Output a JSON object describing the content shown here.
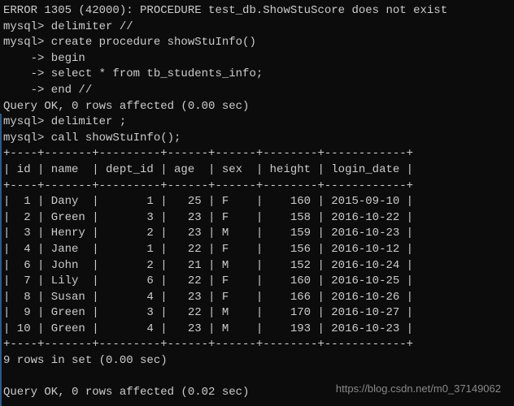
{
  "lines": {
    "l0": "ERROR 1305 (42000): PROCEDURE test_db.ShowStuScore does not exist",
    "l1": "mysql> delimiter //",
    "l2": "mysql> create procedure showStuInfo()",
    "l3": "    -> begin",
    "l4": "    -> select * from tb_students_info;",
    "l5": "    -> end //",
    "l6": "Query OK, 0 rows affected (0.00 sec)",
    "l7": "",
    "l8": "mysql> delimiter ;",
    "l9": "mysql> call showStuInfo();",
    "border": "+----+-------+---------+------+------+--------+------------+",
    "header": "| id | name  | dept_id | age  | sex  | height | login_date |",
    "r1": "|  1 | Dany  |       1 |   25 | F    |    160 | 2015-09-10 |",
    "r2": "|  2 | Green |       3 |   23 | F    |    158 | 2016-10-22 |",
    "r3": "|  3 | Henry |       2 |   23 | M    |    159 | 2016-10-23 |",
    "r4": "|  4 | Jane  |       1 |   22 | F    |    156 | 2016-10-12 |",
    "r5": "|  6 | John  |       2 |   21 | M    |    152 | 2016-10-24 |",
    "r6": "|  7 | Lily  |       6 |   22 | F    |    160 | 2016-10-25 |",
    "r7": "|  8 | Susan |       4 |   23 | F    |    166 | 2016-10-26 |",
    "r8": "|  9 | Green |       3 |   22 | M    |    170 | 2016-10-27 |",
    "r9": "| 10 | Green |       4 |   23 | M    |    193 | 2016-10-23 |",
    "rowsInSet": "9 rows in set (0.00 sec)",
    "queryOk2": "Query OK, 0 rows affected (0.02 sec)"
  },
  "watermark": "https://blog.csdn.net/m0_37149062"
}
